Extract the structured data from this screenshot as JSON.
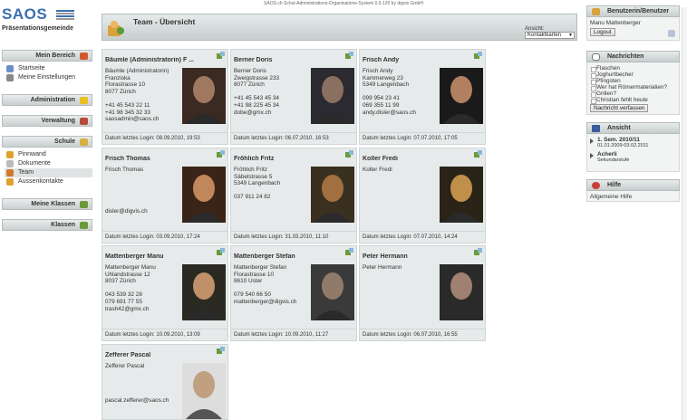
{
  "topbar": "SAOS.ch Schul-Administrations-Organisations-System 0.5.120 by digvis GmbH",
  "logo": {
    "text": "SAOS",
    "org": "Präsentationsgemeinde"
  },
  "sidebar": {
    "sections": [
      {
        "title": "Mein Bereich",
        "items": [
          {
            "label": "Startseite"
          },
          {
            "label": "Meine Einstellungen"
          }
        ]
      },
      {
        "title": "Administration",
        "items": []
      },
      {
        "title": "Verwaltung",
        "items": []
      },
      {
        "title": "Schule",
        "items": [
          {
            "label": "Pinnwand"
          },
          {
            "label": "Dokumente"
          },
          {
            "label": "Team"
          },
          {
            "label": "Aussenkontakte"
          }
        ]
      },
      {
        "title": "Meine Klassen",
        "items": []
      },
      {
        "title": "Klassen",
        "items": []
      }
    ]
  },
  "main": {
    "title": "Team - Übersicht",
    "ansicht_label": "Ansicht:",
    "ansicht_value": "Kontaktkarten"
  },
  "cards": [
    {
      "name": "Bäumle (Administratorin) F ...",
      "body": "Bäumle (Administratorin)\nFranziska\nFlorastrasse 10\n8077 Zürich\n\n+41 45 543 22 11\n+41 98 345 32 33\nsaosadmin@saos.ch",
      "login": "Datum letztes Login: 08.09.2010, 19:53"
    },
    {
      "name": "Berner Doris",
      "body": "Berner Doris\nZweigstrasse 233\n8077 Zürich\n\n+41 45 543 45 34\n+41 98 225 45 34\ndobe@gmx.ch",
      "login": "Datum letztes Login: 06.07.2010, 16:53"
    },
    {
      "name": "Frisch Andy",
      "body": "Frisch Andy\nKammerweg 23\n5349 Langenbach\n\n099 954 23 41\n069 355 11 99\nandy.disler@saos.ch",
      "login": "Datum letztes Login: 07.07.2010, 17:05"
    },
    {
      "name": "Frisch Thomas",
      "body": "Frisch Thomas\n\n\n\n\n\ndisler@digvis.ch",
      "login": "Datum letztes Login: 03.09.2010, 17:24"
    },
    {
      "name": "Fröhlich Fritz",
      "body": "Fröhlich Fritz\nSäbelstrasse 5\n5349 Langenbach\n\n037 911 24 82",
      "login": "Datum letztes Login: 31.03.2010, 11:10"
    },
    {
      "name": "Koller Fredi",
      "body": "Koller Fredi",
      "login": "Datum letztes Login: 07.07.2010, 14:24"
    },
    {
      "name": "Mattenberger Manu",
      "body": "Mattenberger Manu\nUhlandstrasse 12\n8037 Zürich\n\n043 539 32 28\n079 691 77 55\ntrash42@gmx.ch",
      "login": "Datum letztes Login: 10.09.2010, 13:09"
    },
    {
      "name": "Mattenberger Stefan",
      "body": "Mattenberger Stefan\nFlorastrasse 10\n8610 Uster\n\n079 540 66 50\nmattenberger@digvis.ch",
      "login": "Datum letztes Login: 10.09.2010, 11:27"
    },
    {
      "name": "Peter Hermann",
      "body": "Peter Hermann",
      "login": "Datum letztes Login: 06.07.2010, 16:55"
    },
    {
      "name": "Zefferer Pascal",
      "body": "Zefferer Pascal\n\n\n\n\npascal.zefferer@saos.ch",
      "login": ""
    }
  ],
  "right": {
    "user": {
      "title": "Benutzerin/Benutzer",
      "name": "Manu Mattenberger",
      "logout": "Logout"
    },
    "nachrichten": {
      "title": "Nachrichten",
      "items": [
        "Flaschen",
        "Joghurtbecher",
        "Pfingsten",
        "Wer hat Römermaterialien?",
        "Grillen?",
        "Christian fehlt heute"
      ],
      "button": "Nachricht verfassen"
    },
    "ansicht": {
      "title": "Ansicht",
      "sem": "1. Sem. 2010/11",
      "sem_dates": "01.01.2009-03.02.2011",
      "class": "Acherli",
      "class_sub": "Sekundarstufe"
    },
    "hilfe": {
      "title": "Hilfe",
      "item": "Allgemeine Hilfe"
    }
  }
}
